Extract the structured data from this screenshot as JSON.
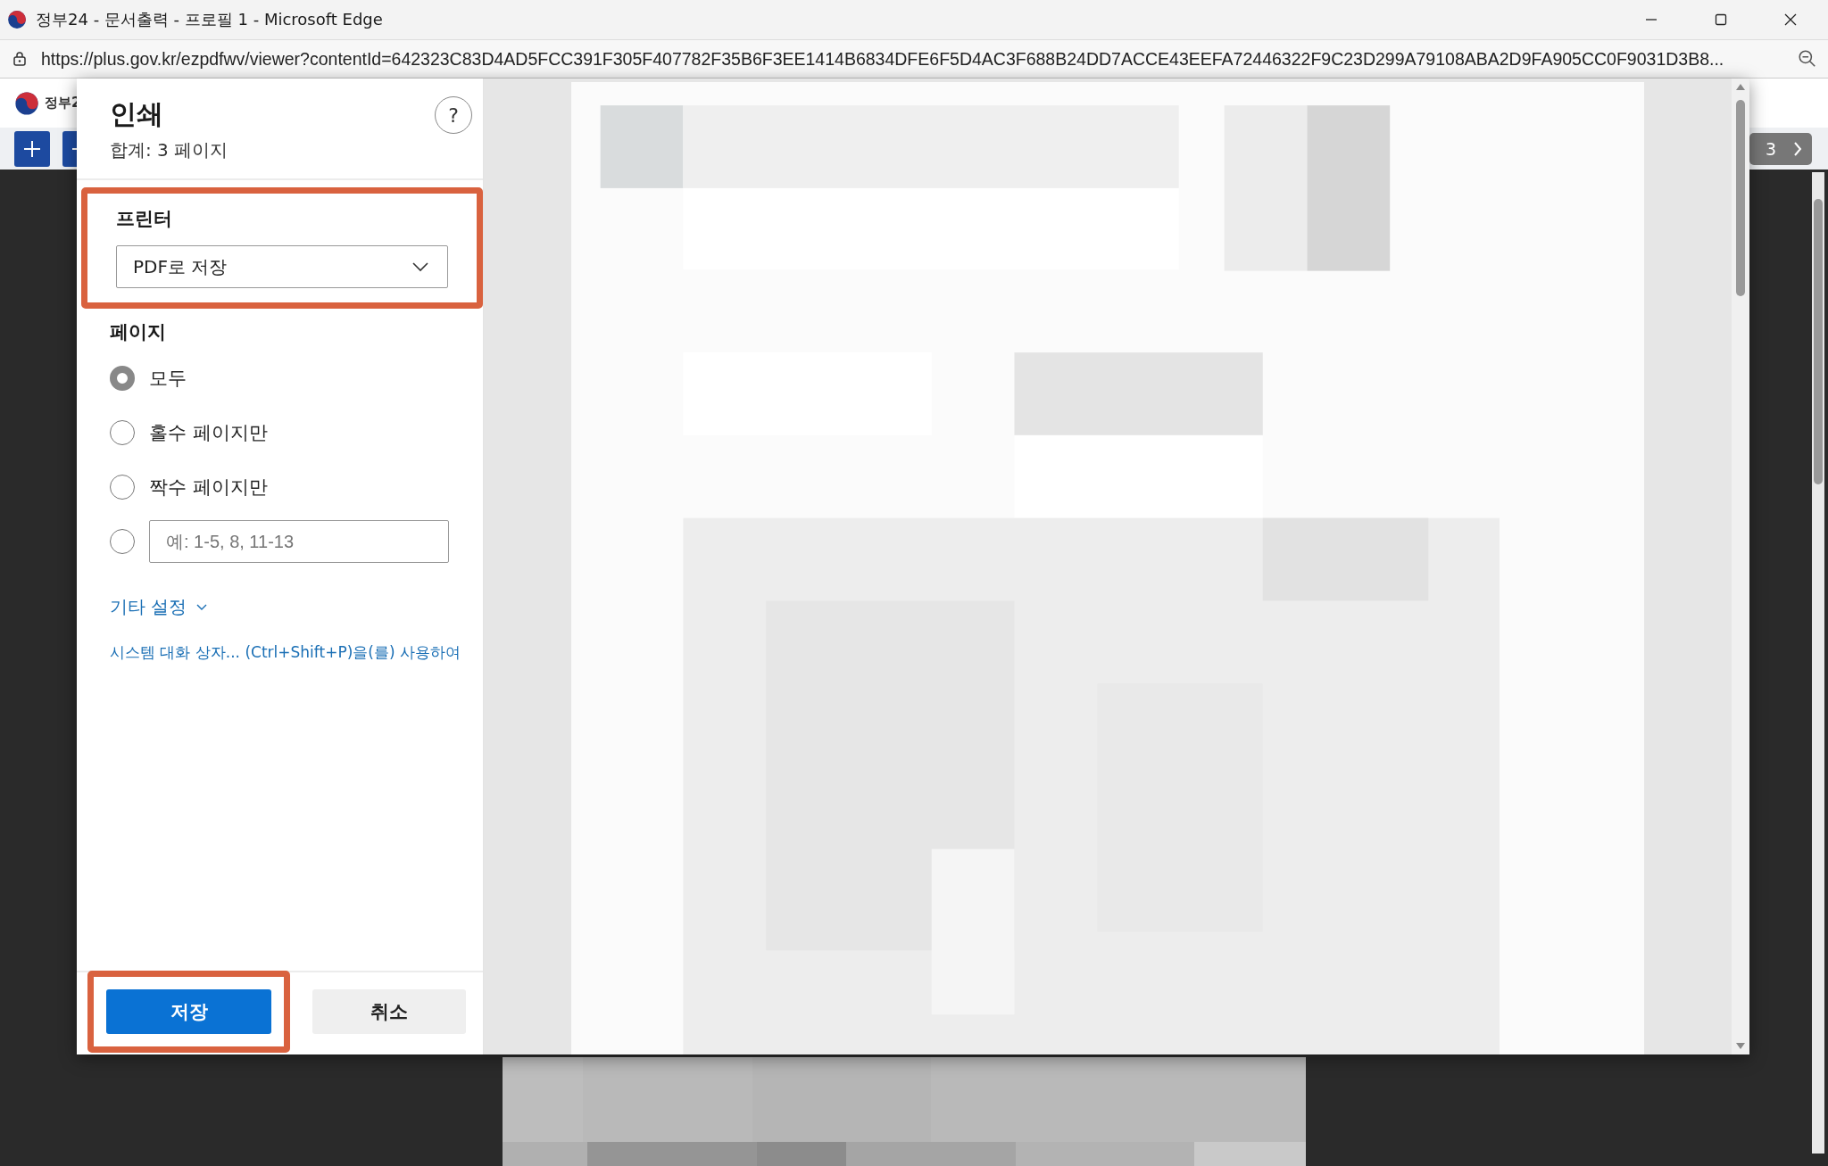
{
  "window": {
    "title": "정부24 - 문서출력 - 프로필 1 - Microsoft Edge",
    "url": "https://plus.gov.kr/ezpdfwv/viewer?contentId=642323C83D4AD5FCC391F305F407782F35B6F3EE1414B6834DFE6F5D4AC3F688B24DD7ACCE43EEFA72446322F9C23D299A79108ABA2D9FA905CC0F9031D3B8..."
  },
  "site": {
    "logo_text": "정부2",
    "page_number": "3"
  },
  "dialog": {
    "title": "인쇄",
    "total": "합계: 3 페이지",
    "help": "?",
    "printer": {
      "label": "프린터",
      "value": "PDF로 저장",
      "highlighted": true
    },
    "pages": {
      "label": "페이지",
      "options": [
        {
          "kind": "text",
          "label": "모두",
          "selected": true
        },
        {
          "kind": "text",
          "label": "홀수 페이지만",
          "selected": false
        },
        {
          "kind": "text",
          "label": "짝수 페이지만",
          "selected": false
        },
        {
          "kind": "range",
          "placeholder": "예: 1-5, 8, 11-13",
          "selected": false
        }
      ]
    },
    "more_settings": "기타 설정",
    "system_dialog_link": "시스템 대화 상자... (Ctrl+Shift+P)을(를) 사용하여",
    "buttons": [
      {
        "kind": "primary",
        "label": "저장",
        "highlighted": true
      },
      {
        "kind": "secondary",
        "label": "취소",
        "highlighted": false
      }
    ]
  }
}
